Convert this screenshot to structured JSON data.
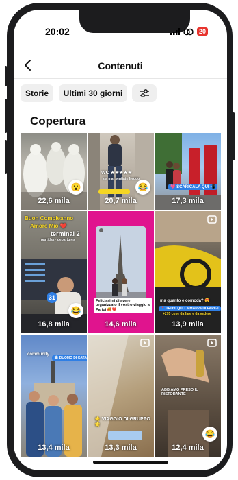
{
  "status_bar": {
    "time": "20:02",
    "battery": "20"
  },
  "header": {
    "title": "Contenuti"
  },
  "filters": {
    "type_label": "Storie",
    "period_label": "Ultimi 30 giorni"
  },
  "section": {
    "title": "Copertura"
  },
  "tiles": [
    {
      "views": "22,6 mila",
      "emoji": "😮"
    },
    {
      "views": "20,7 mila",
      "emoji": "😂",
      "top_text": "WC ★★★★★",
      "sub_text": "sia mai sentiate freddo"
    },
    {
      "views": "17,3 mila",
      "tag": "💖 SCARICALA QUI 📲"
    },
    {
      "views": "16,8 mila",
      "emoji": "😂",
      "line1": "Buon Compleanno",
      "line2": "Amore Mio ❤️",
      "line3": "terminal 2",
      "line4": "partidas · departures",
      "badge": "31"
    },
    {
      "views": "14,6 mila",
      "caption": "Felicissimi di avere organizzato il vostro viaggio a Parigi 🥰❤️"
    },
    {
      "views": "13,9 mila",
      "line1": "ma quanto è comoda? 😍",
      "tag": "📍 TROVI QUI LA MAPPA DI PARIGI",
      "sub_text": "+295 cose da fare e da vedere"
    },
    {
      "views": "13,4 mila",
      "line1": "community",
      "tag": "🏛 DUOMO DI CATANIA"
    },
    {
      "views": "13,3 mila",
      "tag": "🌟 VIAGGIO DI GRUPPO 🌟"
    },
    {
      "views": "12,4 mila",
      "emoji": "😂",
      "line1": "ABBIAMO PRESO IL RISTORANTE"
    }
  ],
  "colors": {
    "accent": "#e8342e",
    "pill_bg": "#efefef",
    "tag_blue": "#2f7fe5",
    "tag_yellow": "#f5d623",
    "magenta": "#e0148e"
  },
  "icons": [
    "back-chevron-icon",
    "signal-icon",
    "wifi-icon",
    "battery-icon",
    "filter-sliders-icon",
    "reel-icon"
  ]
}
